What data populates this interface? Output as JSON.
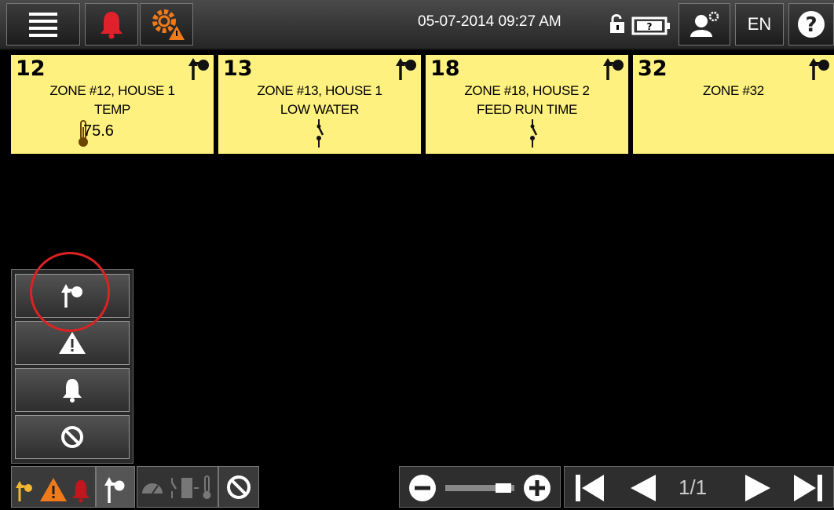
{
  "header": {
    "datetime": "05-07-2014 09:27 AM",
    "language": "EN",
    "icons": [
      "menu-icon",
      "alarm-bell-icon",
      "settings-warning-icon",
      "unlock-icon",
      "battery-icon",
      "user-settings-icon",
      "help-icon"
    ]
  },
  "tiles": [
    {
      "number": "12",
      "line1": "ZONE #12, HOUSE 1",
      "line2": "TEMP",
      "value": "75.6",
      "icon": "thermometer-icon"
    },
    {
      "number": "13",
      "line1": "ZONE #13, HOUSE 1",
      "line2": "LOW WATER",
      "icon": "switch-icon"
    },
    {
      "number": "18",
      "line1": "ZONE #18, HOUSE 2",
      "line2": "FEED RUN TIME",
      "icon": "switch-icon"
    },
    {
      "number": "32",
      "line1": "ZONE #32",
      "line2": ""
    }
  ],
  "side_menu": {
    "items": [
      "filter-override-icon",
      "warning-icon",
      "bell-icon",
      "disabled-icon"
    ]
  },
  "pagination": {
    "page": "1/1"
  },
  "colors": {
    "tile_bg": "#fef180",
    "alarm_red": "#e0202a",
    "warning_orange": "#f07a1a",
    "highlight_circle": "#d22222"
  }
}
